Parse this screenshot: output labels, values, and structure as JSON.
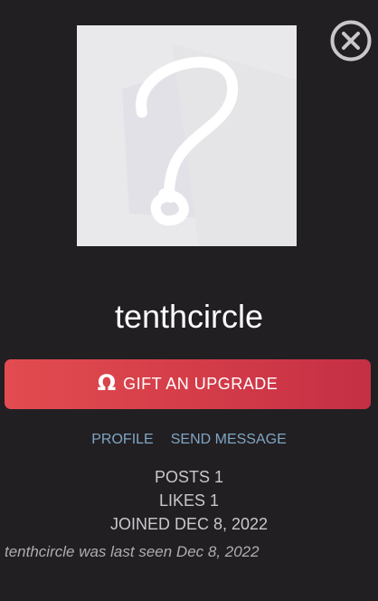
{
  "profile": {
    "username": "tenthcircle",
    "avatar_placeholder": "?"
  },
  "actions": {
    "gift_icon": "Ω",
    "gift_label": "GIFT AN UPGRADE",
    "profile_link": "PROFILE",
    "message_link": "SEND MESSAGE"
  },
  "stats": {
    "posts": "POSTS 1",
    "likes": "LIKES 1",
    "joined": "JOINED DEC 8, 2022"
  },
  "status": {
    "last_seen": "tenthcircle was last seen Dec 8, 2022"
  },
  "icons": {
    "close": "close-icon",
    "gift": "omega-icon"
  },
  "colors": {
    "background": "#221f23",
    "button_gradient_start": "#e24c50",
    "button_gradient_end": "#c52f45",
    "link": "#7fa6c2"
  }
}
